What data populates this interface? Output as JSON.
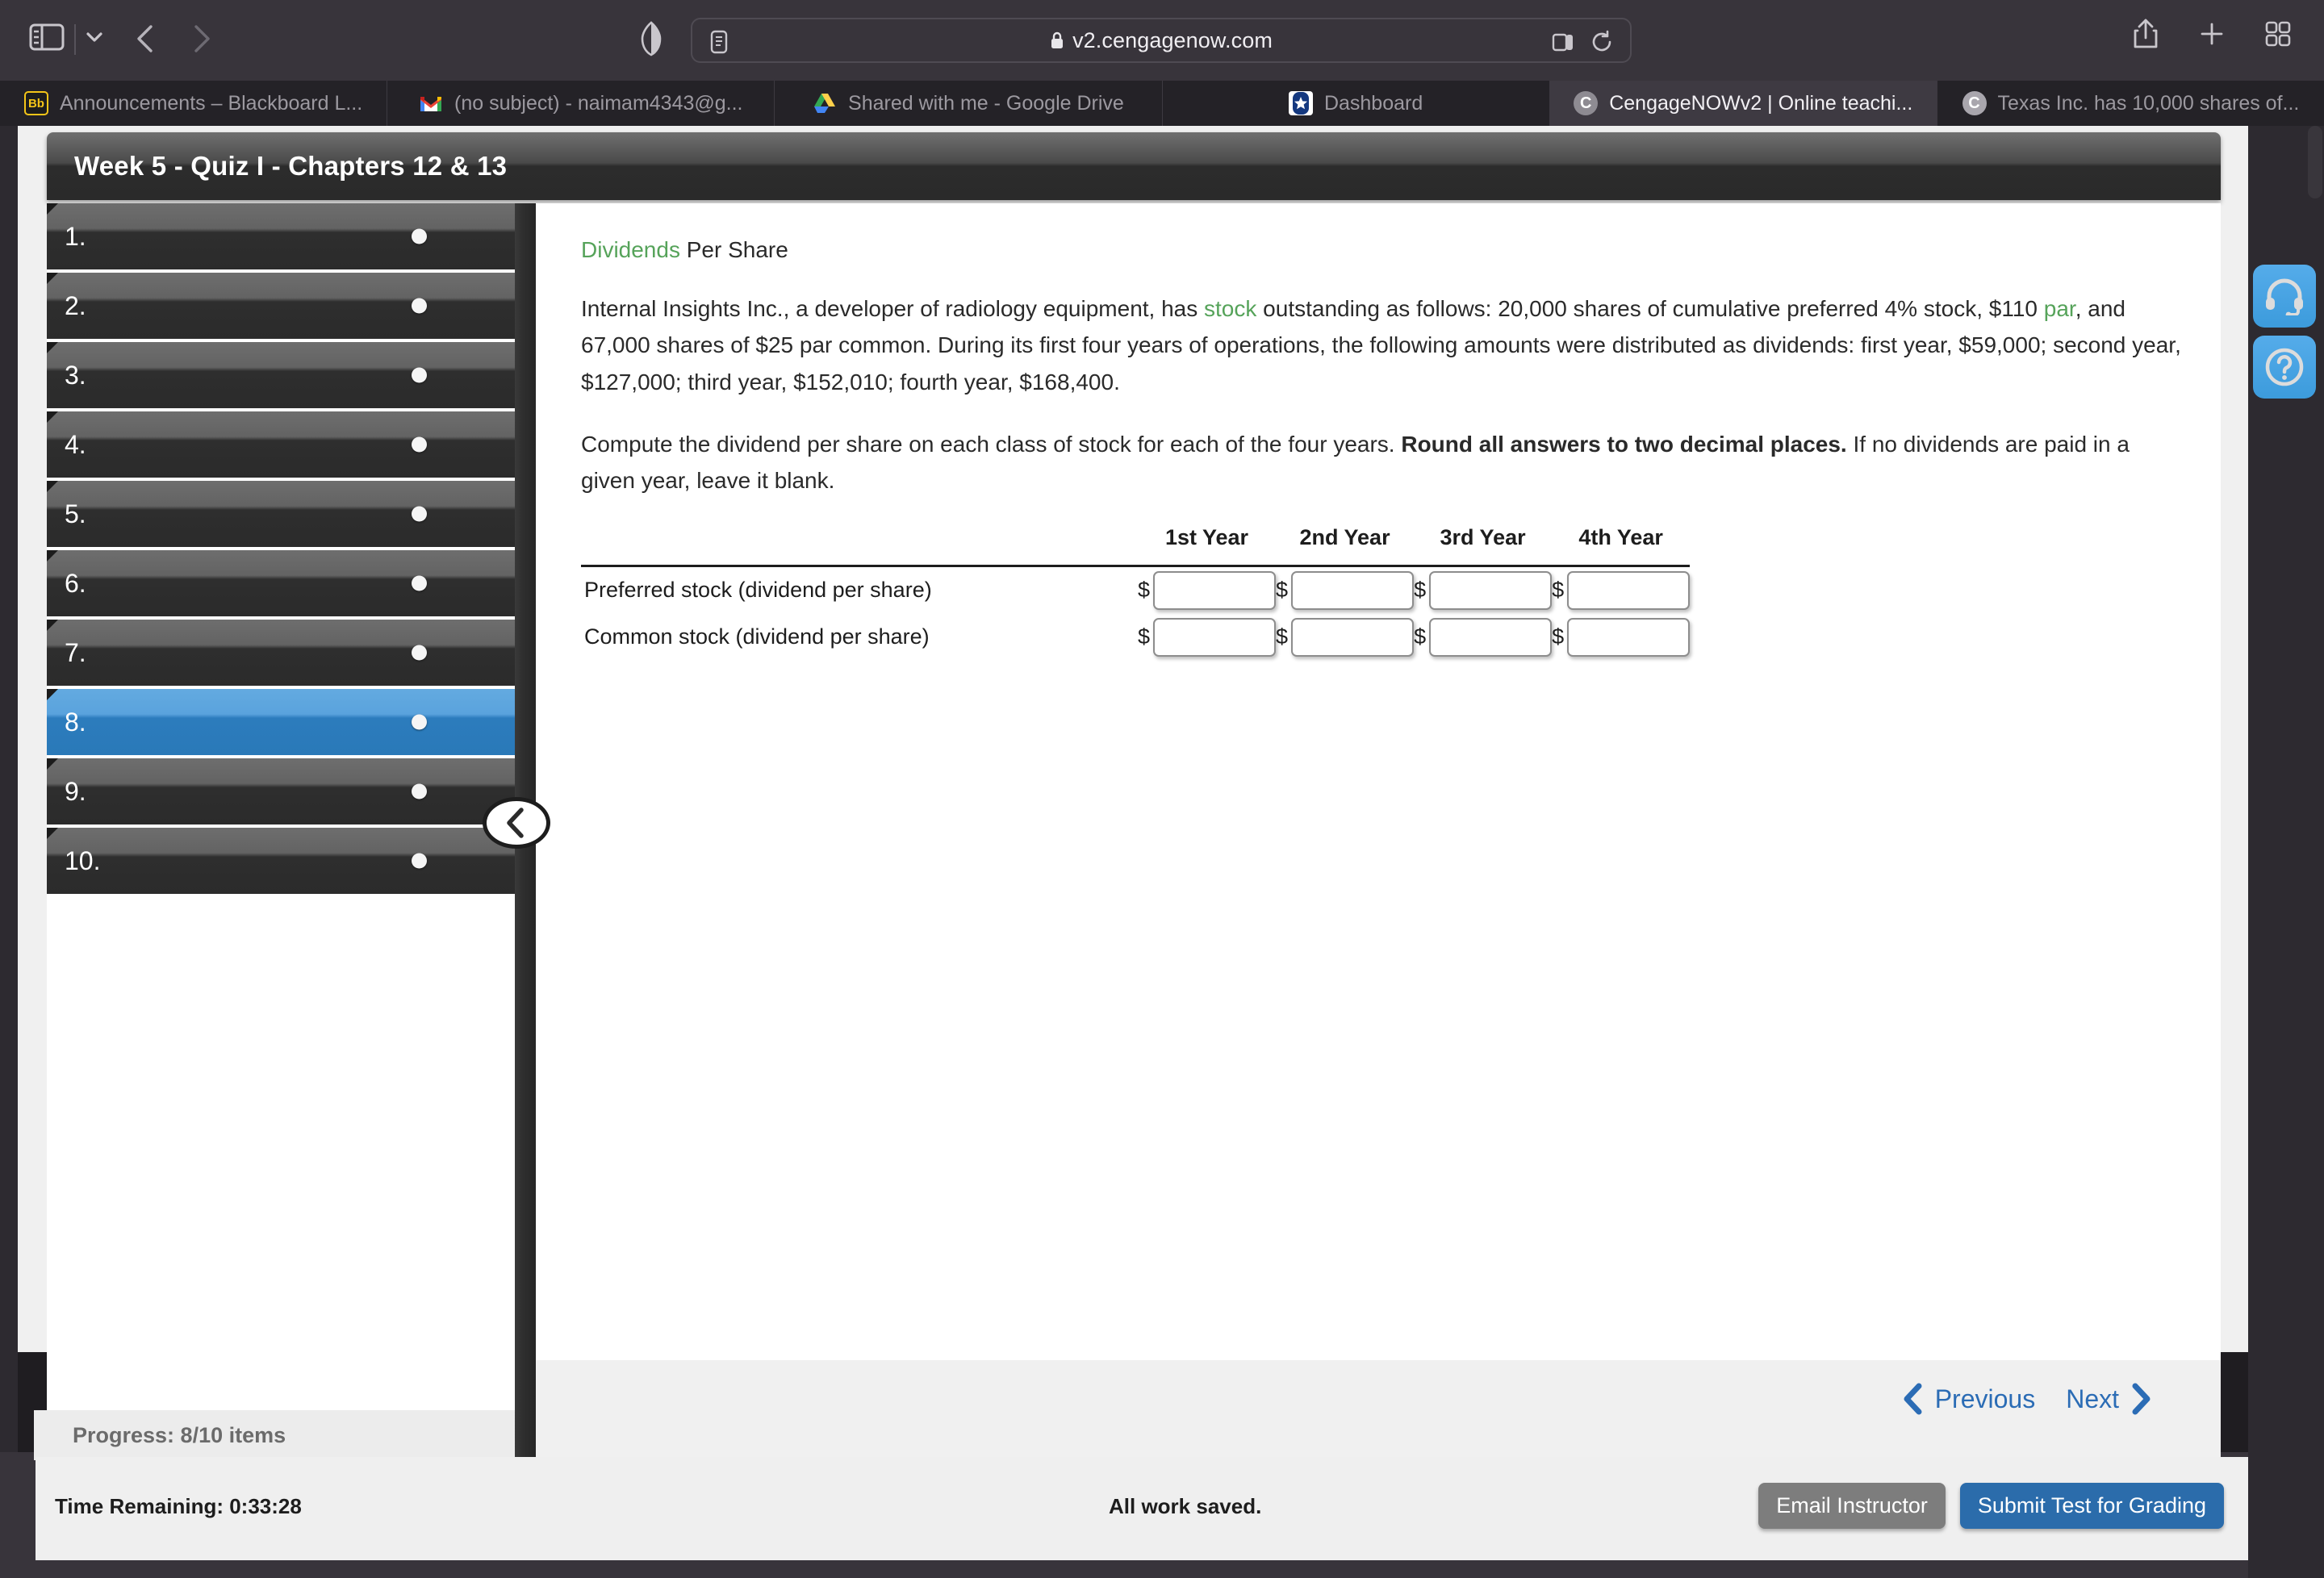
{
  "browser": {
    "url": "v2.cengagenow.com",
    "icons": {
      "sidebar_toggle": "sidebar-toggle-icon",
      "sidebar_dropdown": "chevron-down-icon",
      "back": "back-chevron-icon",
      "forward": "forward-chevron-icon",
      "shield": "privacy-shield-icon",
      "reader": "reader-view-icon",
      "lock": "lock-icon",
      "tab_group": "tab-group-icon",
      "reload": "reload-icon",
      "share": "share-icon",
      "new_tab": "plus-icon",
      "tab_overview": "tab-overview-icon"
    },
    "tabs": [
      {
        "title": "Announcements – Blackboard L...",
        "favicon": "blackboard-icon",
        "active": false
      },
      {
        "title": "(no subject) - naimam4343@g...",
        "favicon": "gmail-icon",
        "active": false
      },
      {
        "title": "Shared with me - Google Drive",
        "favicon": "google-drive-icon",
        "active": false
      },
      {
        "title": "Dashboard",
        "favicon": "dashboard-star-icon",
        "active": false
      },
      {
        "title": "CengageNOWv2 | Online teachi...",
        "favicon": "cengage-icon",
        "active": true
      },
      {
        "title": "Texas Inc. has 10,000 shares of...",
        "favicon": "cengage-icon",
        "active": false
      }
    ]
  },
  "quiz": {
    "title": "Week 5 - Quiz I - Chapters 12 & 13",
    "nav_items": [
      {
        "label": "1.",
        "selected": false
      },
      {
        "label": "2.",
        "selected": false
      },
      {
        "label": "3.",
        "selected": false
      },
      {
        "label": "4.",
        "selected": false
      },
      {
        "label": "5.",
        "selected": false
      },
      {
        "label": "6.",
        "selected": false
      },
      {
        "label": "7.",
        "selected": false
      },
      {
        "label": "8.",
        "selected": true
      },
      {
        "label": "9.",
        "selected": false
      },
      {
        "label": "10.",
        "selected": false
      }
    ],
    "progress": "Progress:  8/10 items",
    "collapse_icon": "collapse-left-chevron-icon"
  },
  "question": {
    "heading_link": "Dividends",
    "heading_rest": " Per Share",
    "para1_a": "Internal Insights Inc., a developer of radiology equipment, has ",
    "para1_link1": "stock",
    "para1_b": " outstanding as follows: 20,000 shares of cumulative preferred 4% stock, $110 ",
    "para1_link2": "par",
    "para1_c": ", and 67,000 shares of $25 par common. During its first four years of operations, the following amounts were distributed as dividends: first year, $59,000; second year, $127,000; third year, $152,010; fourth year, $168,400.",
    "para2_a": "Compute the dividend per share on each class of stock for each of the four years. ",
    "para2_bold": "Round all answers to two decimal places.",
    "para2_b": " If no dividends are paid in a given year, leave it blank."
  },
  "answer_table": {
    "column_headers": [
      "1st Year",
      "2nd Year",
      "3rd Year",
      "4th Year"
    ],
    "currency_symbol": "$",
    "rows": [
      {
        "label": "Preferred stock (dividend per share)",
        "values": [
          "",
          "",
          "",
          ""
        ]
      },
      {
        "label": "Common stock (dividend per share)",
        "values": [
          "",
          "",
          "",
          ""
        ]
      }
    ]
  },
  "pager": {
    "previous_label": "Previous",
    "next_label": "Next",
    "previous_icon": "previous-chevron-icon",
    "next_icon": "next-chevron-icon"
  },
  "footer": {
    "time_remaining": "Time Remaining: 0:33:28",
    "save_status": "All work saved.",
    "email_instructor_label": "Email Instructor",
    "submit_label": "Submit Test for Grading"
  },
  "help_rail": {
    "headset_icon": "headset-support-icon",
    "help_icon": "question-mark-help-icon"
  },
  "colors": {
    "accent_blue": "#2b6cab",
    "selected_item_blue": "#2c7cbd",
    "link_green": "#56a35a",
    "help_button_blue": "#3c9bdc",
    "chrome_dark": "#38343b"
  }
}
